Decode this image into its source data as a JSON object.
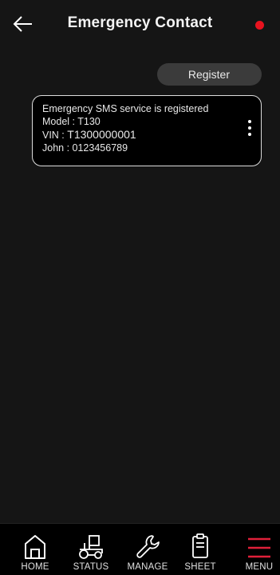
{
  "header": {
    "title": "Emergency Contact",
    "back_icon": "arrow-left-icon",
    "status_dot_color": "#e8131f"
  },
  "actions": {
    "register_label": "Register"
  },
  "contact_card": {
    "line1": "Emergency SMS service is registered",
    "model": "Model : T130",
    "vin_prefix": "VIN : ",
    "vin_value": "T1300000001",
    "contact": "John : 0123456789",
    "menu_icon": "more-vertical-icon"
  },
  "bottom_nav": {
    "items": [
      {
        "label": "HOME",
        "icon": "home-icon"
      },
      {
        "label": "STATUS",
        "icon": "tractor-icon"
      },
      {
        "label": "MANAGE",
        "icon": "wrench-icon"
      },
      {
        "label": "SHEET",
        "icon": "clipboard-icon"
      },
      {
        "label": "MENU",
        "icon": "hamburger-menu-icon"
      }
    ],
    "active_color": "#e0203a"
  }
}
